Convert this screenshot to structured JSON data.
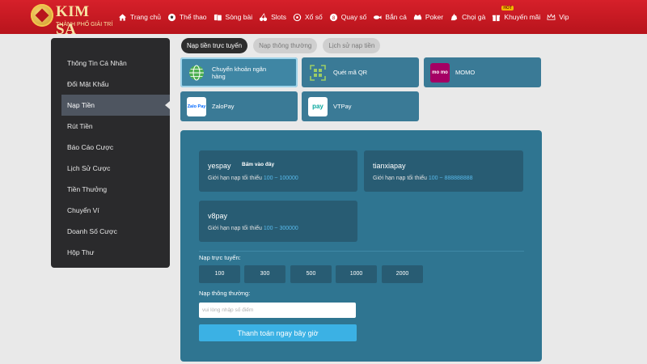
{
  "brand": {
    "name": "KIM SA",
    "tagline": "THÀNH PHỐ GIẢI TRÍ"
  },
  "nav": [
    {
      "label": "Trang chủ",
      "icon": "home-icon"
    },
    {
      "label": "Thể thao",
      "icon": "soccer-ball-icon"
    },
    {
      "label": "Sòng bài",
      "icon": "cards-icon"
    },
    {
      "label": "Slots",
      "icon": "cherry-icon"
    },
    {
      "label": "Xổ số",
      "icon": "lottery-icon"
    },
    {
      "label": "Quay số",
      "icon": "dial-icon"
    },
    {
      "label": "Bắn cá",
      "icon": "fish-icon"
    },
    {
      "label": "Poker",
      "icon": "poker-icon"
    },
    {
      "label": "Chọi gà",
      "icon": "rooster-icon"
    },
    {
      "label": "Khuyến mãi",
      "icon": "gift-icon",
      "badge": "HOT"
    },
    {
      "label": "Vip",
      "icon": "crown-icon"
    }
  ],
  "sidebar": {
    "items": [
      {
        "label": "Thông Tin Cá Nhân"
      },
      {
        "label": "Đổi Mật Khẩu"
      },
      {
        "label": "Nạp Tiền",
        "active": true
      },
      {
        "label": "Rút Tiền"
      },
      {
        "label": "Báo Cáo Cược"
      },
      {
        "label": "Lịch Sử Cược"
      },
      {
        "label": "Tiền Thưởng"
      },
      {
        "label": "Chuyển Ví"
      },
      {
        "label": "Doanh Số Cược"
      },
      {
        "label": "Hộp Thư"
      }
    ]
  },
  "tabs": [
    {
      "label": "Nạp tiền trực tuyến",
      "active": true
    },
    {
      "label": "Nạp thông thường"
    },
    {
      "label": "Lịch sử nạp tiền"
    }
  ],
  "methods": [
    {
      "label": "Chuyển khoản ngân hàng",
      "icon": "globe-icon",
      "active": true
    },
    {
      "label": "Quét mã QR",
      "icon": "qr-code-icon"
    },
    {
      "label": "MOMO",
      "icon": "momo-icon",
      "icon_text": "mo mo"
    },
    {
      "label": "ZaloPay",
      "icon": "zalopay-icon",
      "icon_text": "Zalo Pay"
    },
    {
      "label": "VTPay",
      "icon": "vtpay-icon",
      "icon_text": "pay"
    }
  ],
  "gateways": [
    {
      "name": "yespay",
      "hint": "Bấm vào đây",
      "limit_label": "Giới hạn nạp tối thiểu",
      "range": "100 ~ 100000"
    },
    {
      "name": "tianxiapay",
      "hint": "",
      "limit_label": "Giới hạn nạp tối thiểu",
      "range": "100 ~ 888888888"
    },
    {
      "name": "v8pay",
      "hint": "",
      "limit_label": "Giới hạn nạp tối thiểu",
      "range": "100 ~ 300000"
    }
  ],
  "online_deposit": {
    "label": "Nạp trực tuyến:",
    "amounts": [
      "100",
      "300",
      "500",
      "1000",
      "2000"
    ]
  },
  "normal_deposit": {
    "label": "Nạp thông thường:",
    "placeholder": "vui lòng nhập số điểm",
    "submit_label": "Thanh toán ngay bây giờ"
  },
  "colors": {
    "topbar": "#c8161f",
    "sidebar": "#2a2a2c",
    "panel": "#2f7591",
    "accent": "#3bb1e4"
  }
}
